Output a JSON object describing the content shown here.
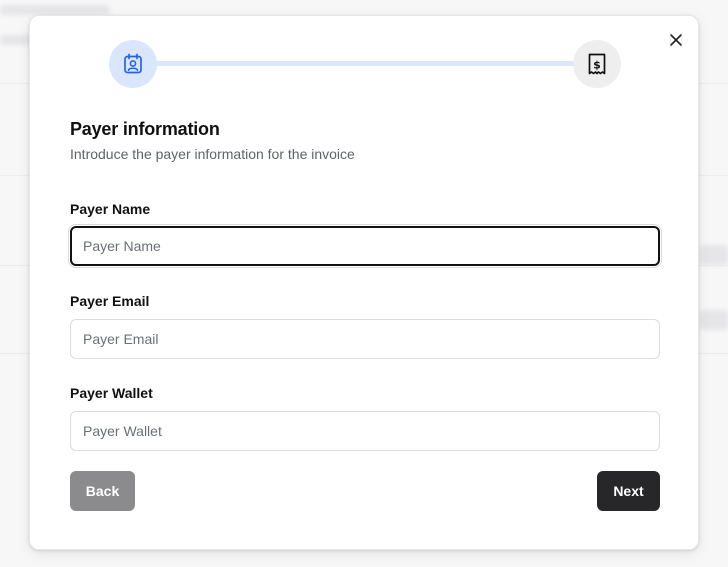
{
  "dialog": {
    "title": "Payer information",
    "subtitle": "Introduce the payer information for the invoice",
    "close_icon": "close-icon"
  },
  "stepper": {
    "steps": [
      {
        "icon": "contact-card-icon",
        "state": "active"
      },
      {
        "icon": "invoice-receipt-icon",
        "state": "upcoming"
      }
    ],
    "active_color": "#2563eb",
    "track_color": "#dbe7fb"
  },
  "form": {
    "fields": [
      {
        "label": "Payer Name",
        "placeholder": "Payer Name",
        "value": "",
        "focused": true
      },
      {
        "label": "Payer Email",
        "placeholder": "Payer Email",
        "value": "",
        "focused": false
      },
      {
        "label": "Payer Wallet",
        "placeholder": "Payer Wallet",
        "value": "",
        "focused": false
      }
    ]
  },
  "actions": {
    "back_label": "Back",
    "next_label": "Next"
  }
}
